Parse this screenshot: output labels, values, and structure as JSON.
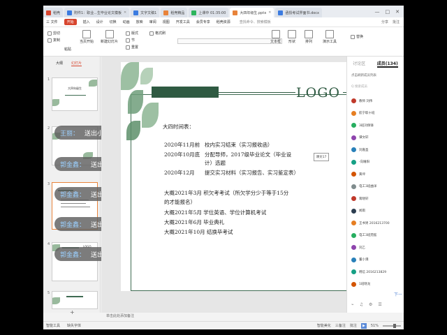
{
  "tabs": [
    {
      "label": "稻壳",
      "color": "#d7452e"
    },
    {
      "label": "附件1：职业...生毕业论文模板",
      "color": "#3b7be0"
    },
    {
      "label": "文字文稿1",
      "color": "#3b7be0"
    },
    {
      "label": "稻壳精品",
      "color": "#e8833a"
    },
    {
      "label": "上课中 01:35:00",
      "color": "#2db55d"
    },
    {
      "label": "大四年级生.pptx",
      "color": "#e8833a",
      "active": true
    },
    {
      "label": "函授考试界面书.docx",
      "color": "#3b7be0"
    }
  ],
  "window_controls": [
    "—",
    "□",
    "✕"
  ],
  "menu": {
    "items": [
      "三 文件",
      "开始",
      "插入",
      "设计",
      "切换",
      "动画",
      "放映",
      "审阅",
      "视图",
      "开发工具",
      "会员专享",
      "稻壳资源"
    ],
    "search": "查找命令、搜索模板",
    "right": [
      "分享",
      "批注"
    ]
  },
  "ribbon": {
    "paste": "粘贴",
    "cut": "剪切",
    "copy": "复制",
    "format_painter": "格式刷",
    "from_start": "当页开始",
    "new_slide": "新建幻灯片",
    "layout": "版式",
    "section": "节",
    "reset": "重置",
    "textbox": "文本框",
    "shape": "形状",
    "arrange": "排列",
    "present": "演示工具",
    "replace": "替换"
  },
  "left_panel": {
    "view_tabs": [
      "大纲",
      "幻灯片"
    ],
    "slide_numbers": [
      "1",
      "2",
      "3",
      "4",
      "5"
    ],
    "thumb1_title": "大四年级生",
    "thumb4_logo": "LOGO",
    "add_symbol": "+"
  },
  "danmaku": [
    {
      "name": "王丽：",
      "text": "送出小花"
    },
    {
      "name": "郭金鑫：",
      "text": "送出小花"
    },
    {
      "name": "郭金鑫：",
      "text": "送出小花"
    },
    {
      "name": "郭金鑫：",
      "text": "送出小花"
    },
    {
      "name": "郭金鑫：",
      "text": "送出小花"
    }
  ],
  "slide": {
    "logo": "LOGO",
    "heading": "大四时间表：",
    "lines": [
      {
        "t": "2020年11月前",
        "d": "校内实习结束（实习报收函）"
      },
      {
        "t": "2020年10月底",
        "d": "分配导师，2017级毕业论文（毕业设"
      },
      {
        "t": "",
        "d": "计）选题"
      },
      {
        "t": "2020年12月",
        "d": "提交实习材料（实习报告、实习鉴定表）"
      }
    ],
    "lines2": [
      "大概2021年3月   积欠考考试（所欠学分少于等于15分",
      "的才能报名）",
      "大概2021年5月   学位英语、学位计算机考试",
      "大概2021年6月   毕业典礼",
      "大概2021年10月  结换毕考试"
    ],
    "textbox_tag": "课文17"
  },
  "notes": "单击此处添加备注",
  "right_panel": {
    "tab_discuss": "讨论区",
    "tab_members": "成员(134)",
    "hint": "点击刷新成员列表",
    "search": "Q  搜索成员",
    "members": [
      {
        "name": "教师 刘伟",
        "color": "#c0392b"
      },
      {
        "name": "航宁取十班",
        "color": "#e67e22"
      },
      {
        "name": "3班刘保锋",
        "color": "#27ae60"
      },
      {
        "name": "谭文轩",
        "color": "#8e44ad"
      },
      {
        "name": "刘嘉圣",
        "color": "#2980b9"
      },
      {
        "name": "-向睡阳",
        "color": "#16a085"
      },
      {
        "name": "黄坪",
        "color": "#d35400"
      },
      {
        "name": "电工3班曲洋",
        "color": "#7f8c8d"
      },
      {
        "name": "蒋晓轩",
        "color": "#c0392b"
      },
      {
        "name": "闻雨",
        "color": "#2c3e50"
      },
      {
        "name": "王书男 2016213700",
        "color": "#e67e22"
      },
      {
        "name": "电工3班苑舷",
        "color": "#27ae60"
      },
      {
        "name": "刘乙",
        "color": "#8e44ad"
      },
      {
        "name": "董小濠",
        "color": "#2980b9"
      },
      {
        "name": "韩信 2016213829",
        "color": "#16a085"
      },
      {
        "name": "1班晓龙",
        "color": "#d35400"
      }
    ],
    "bottom_icons": [
      "⌁",
      "♫",
      "⚙",
      "☰"
    ],
    "next": "下一"
  },
  "status": {
    "left": "智能工具",
    "font_missing": "缺失字体",
    "right": [
      "智能美化",
      "三备注",
      "批注"
    ],
    "play": "▶",
    "zoom": "51%"
  }
}
